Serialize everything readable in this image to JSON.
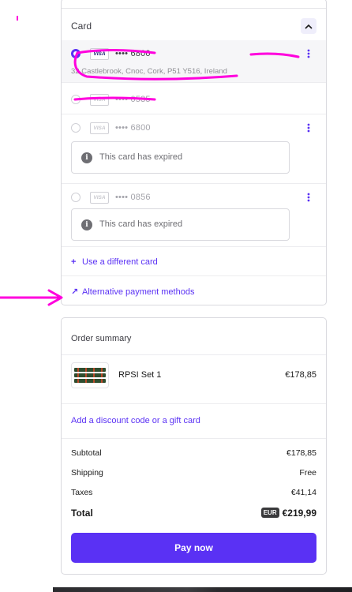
{
  "payment": {
    "section_title": "Card",
    "cards": [
      {
        "brand": "VISA",
        "masked": "•••• 6800",
        "address": "32 Castlebrook, Cnoc, Cork, P51 Y516, Ireland",
        "selected": true
      },
      {
        "brand": "VISA",
        "masked": "•••• 0535",
        "selected": false
      },
      {
        "brand": "VISA",
        "masked": "•••• 6800",
        "expired_msg": "This card has expired",
        "selected": false
      },
      {
        "brand": "VISA",
        "masked": "•••• 0856",
        "expired_msg": "This card has expired",
        "selected": false
      }
    ],
    "use_different_card": "Use a different card",
    "alternative_methods": "Alternative payment methods"
  },
  "summary": {
    "title": "Order summary",
    "product_name": "RPSI Set 1",
    "product_price": "€178,85",
    "discount_link": "Add a discount code or a gift card",
    "subtotal_label": "Subtotal",
    "subtotal_value": "€178,85",
    "shipping_label": "Shipping",
    "shipping_value": "Free",
    "taxes_label": "Taxes",
    "taxes_value": "€41,14",
    "total_label": "Total",
    "currency": "EUR",
    "total_value": "€219,99",
    "pay_button": "Pay now"
  },
  "icons": {
    "collapse": "chevron-up-icon",
    "kebab": "vertical-dots-icon",
    "info": "info-icon",
    "plus": "plus-icon",
    "arrow": "arrow-up-right-icon"
  },
  "colors": {
    "accent": "#5a31f4",
    "annotation": "#ff00dd"
  }
}
